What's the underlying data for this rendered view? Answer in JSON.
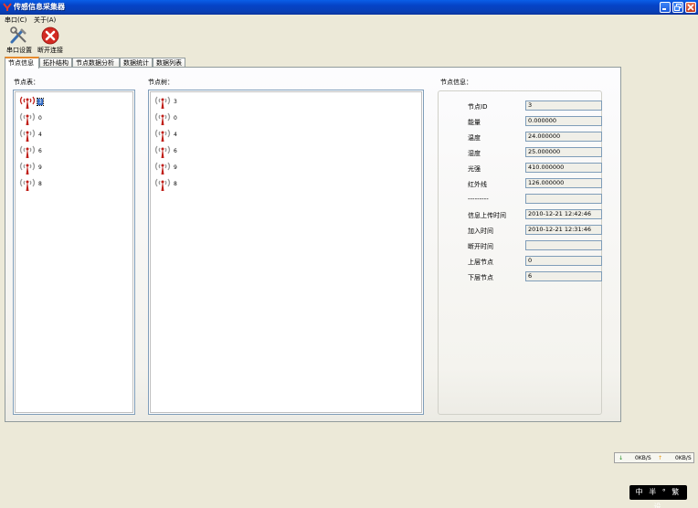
{
  "window": {
    "title": "传感信息采集器"
  },
  "menu": [
    {
      "label": "串口(C)"
    },
    {
      "label": "关于(A)"
    }
  ],
  "toolbar": {
    "serial_settings": "串口设置",
    "disconnect": "断开连接"
  },
  "tabs": [
    {
      "label": "节点信息"
    },
    {
      "label": "拓扑结构"
    },
    {
      "label": "节点数据分析"
    },
    {
      "label": "数据统计"
    },
    {
      "label": "数据列表"
    }
  ],
  "node_table": {
    "label": "节点表：",
    "items": [
      "3",
      "0",
      "4",
      "6",
      "9",
      "8"
    ],
    "selected_index": 0
  },
  "node_tree": {
    "label": "节点树：",
    "items": [
      "3",
      "0",
      "4",
      "6",
      "9",
      "8"
    ]
  },
  "node_info": {
    "label": "节点信息：",
    "fields": [
      {
        "label": "节点ID",
        "value": "3"
      },
      {
        "label": "能量",
        "value": "0.000000"
      },
      {
        "label": "温度",
        "value": "24.000000"
      },
      {
        "label": "湿度",
        "value": "25.000000"
      },
      {
        "label": "光强",
        "value": "410.000000"
      },
      {
        "label": "红外线",
        "value": "126.000000"
      },
      {
        "label": "---------",
        "value": ""
      },
      {
        "label": "信息上传时间",
        "value": "2010-12-21 12:42:46"
      },
      {
        "label": "加入时间",
        "value": "2010-12-21 12:31:46"
      },
      {
        "label": "断开时间",
        "value": ""
      },
      {
        "label": "上层节点",
        "value": "0"
      },
      {
        "label": "下层节点",
        "value": "6"
      }
    ]
  },
  "status": {
    "down_speed": "0KB/S",
    "up_speed": "0KB/S"
  },
  "ime": {
    "text": "中 半 ° 繁 设"
  },
  "colors": {
    "titlebar": "#0543c6",
    "tab_accent": "#e68b2c",
    "selection": "#316ac5",
    "antenna": "#c0201a"
  }
}
